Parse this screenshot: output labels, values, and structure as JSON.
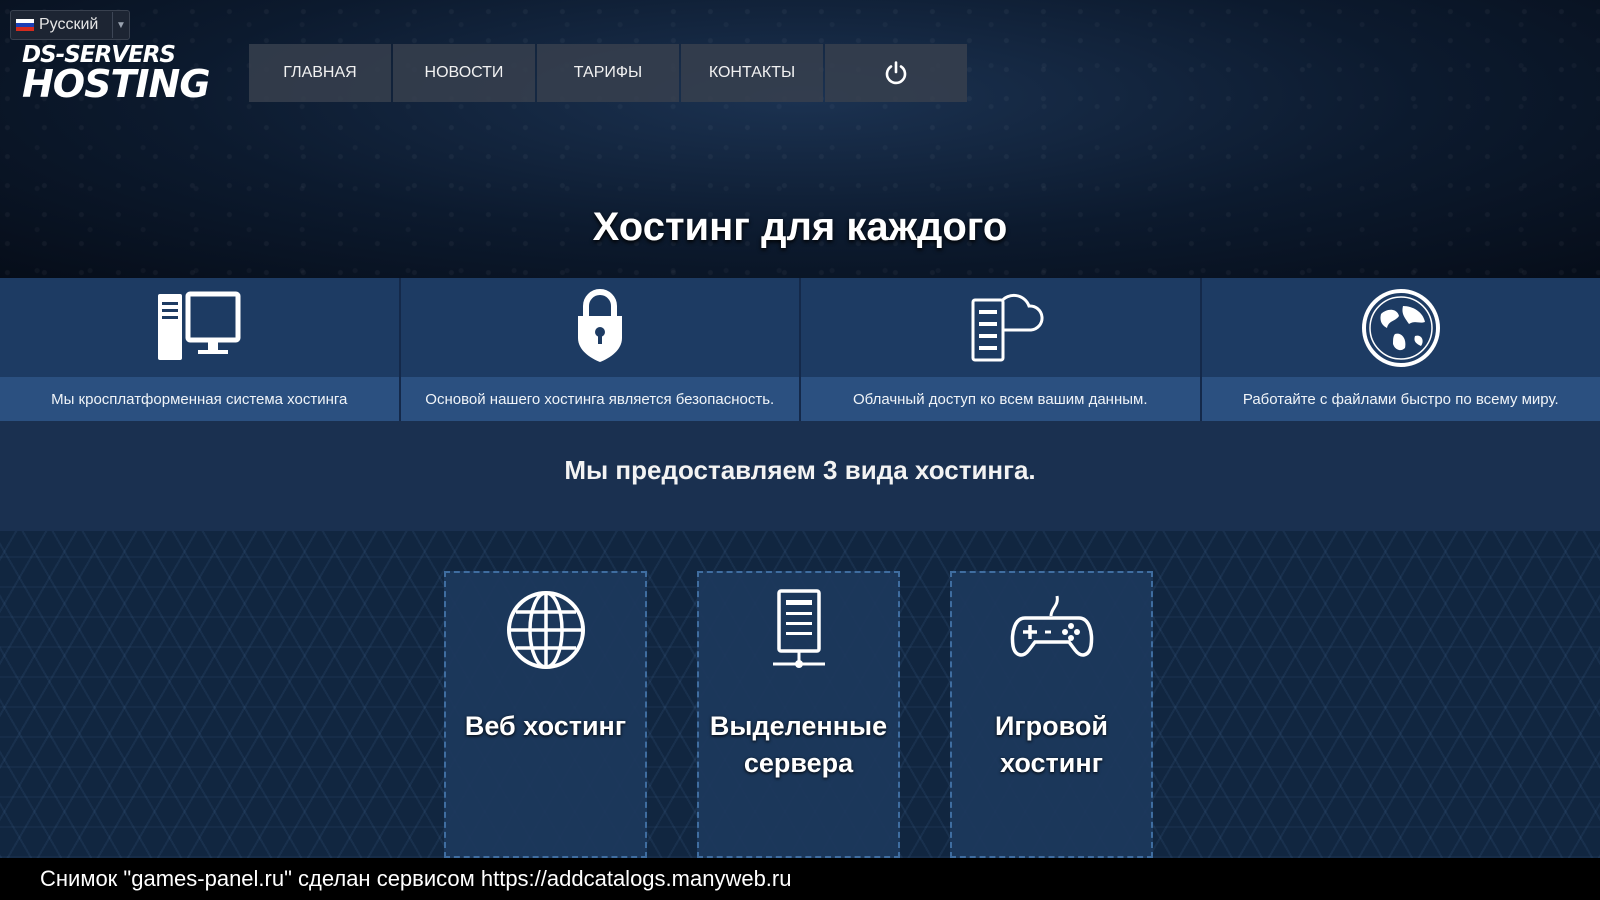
{
  "language": {
    "label": "Русский",
    "flag_colors": [
      "#ffffff",
      "#1c3fb5",
      "#d52b1e"
    ]
  },
  "logo": {
    "line1": "DS-SERVERS",
    "line2": "HOSTING"
  },
  "nav": {
    "items": [
      "ГЛАВНАЯ",
      "НОВОСТИ",
      "ТАРИФЫ",
      "КОНТАКТЫ"
    ],
    "power_icon": "power-icon"
  },
  "hero": {
    "title": "Хостинг для каждого"
  },
  "features": [
    {
      "icon": "desktop-computer-icon",
      "caption": "Мы кросплатформенная система хостинга"
    },
    {
      "icon": "padlock-icon",
      "caption": "Основой нашего хостинга является безопасность."
    },
    {
      "icon": "cloud-server-icon",
      "caption": "Облачный доступ ко всем вашим данным."
    },
    {
      "icon": "globe-earth-icon",
      "caption": "Работайте с файлами быстро по всему миру."
    }
  ],
  "subhead": "Мы предоставляем 3 вида хостинга.",
  "cards": [
    {
      "icon": "globe-icon",
      "title": "Веб хостинг"
    },
    {
      "icon": "server-rack-icon",
      "title": "Выделенные сервера"
    },
    {
      "icon": "gamepad-icon",
      "title": "Игровой хостинг"
    }
  ],
  "footer": {
    "text": "Снимок \"games-panel.ru\" сделан сервисом https://addcatalogs.manyweb.ru"
  },
  "colors": {
    "feature_band": "#1d3b63",
    "caption_band": "#2b5080",
    "card_border": "#3f6da0"
  }
}
